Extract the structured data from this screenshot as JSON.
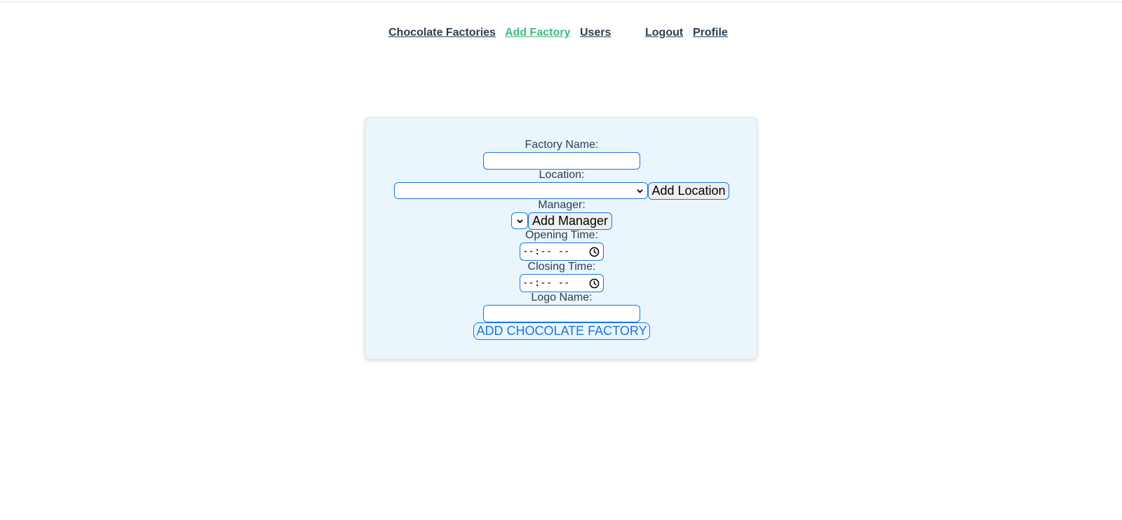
{
  "nav": {
    "factories": "Chocolate Factories",
    "add_factory": "Add Factory",
    "users": "Users",
    "logout": "Logout",
    "profile": "Profile"
  },
  "form": {
    "factory_name_label": "Factory Name:",
    "factory_name_value": "",
    "location_label": "Location:",
    "location_selected": "",
    "add_location_label": "Add Location",
    "manager_label": "Manager:",
    "manager_selected": "",
    "add_manager_label": "Add Manager",
    "opening_time_label": "Opening Time:",
    "opening_time_value": "--:-- --",
    "closing_time_label": "Closing Time:",
    "closing_time_value": "--:-- --",
    "logo_name_label": "Logo Name:",
    "logo_name_value": "",
    "submit_label": "ADD CHOCOLATE FACTORY"
  },
  "icons": {
    "select_arrow": "chevron-down-icon",
    "time_picker": "clock-icon"
  },
  "colors": {
    "text": "#2c3e50",
    "active_link": "#42b983",
    "field_border": "#1a73e8",
    "card_background": "#eaf6fc"
  }
}
